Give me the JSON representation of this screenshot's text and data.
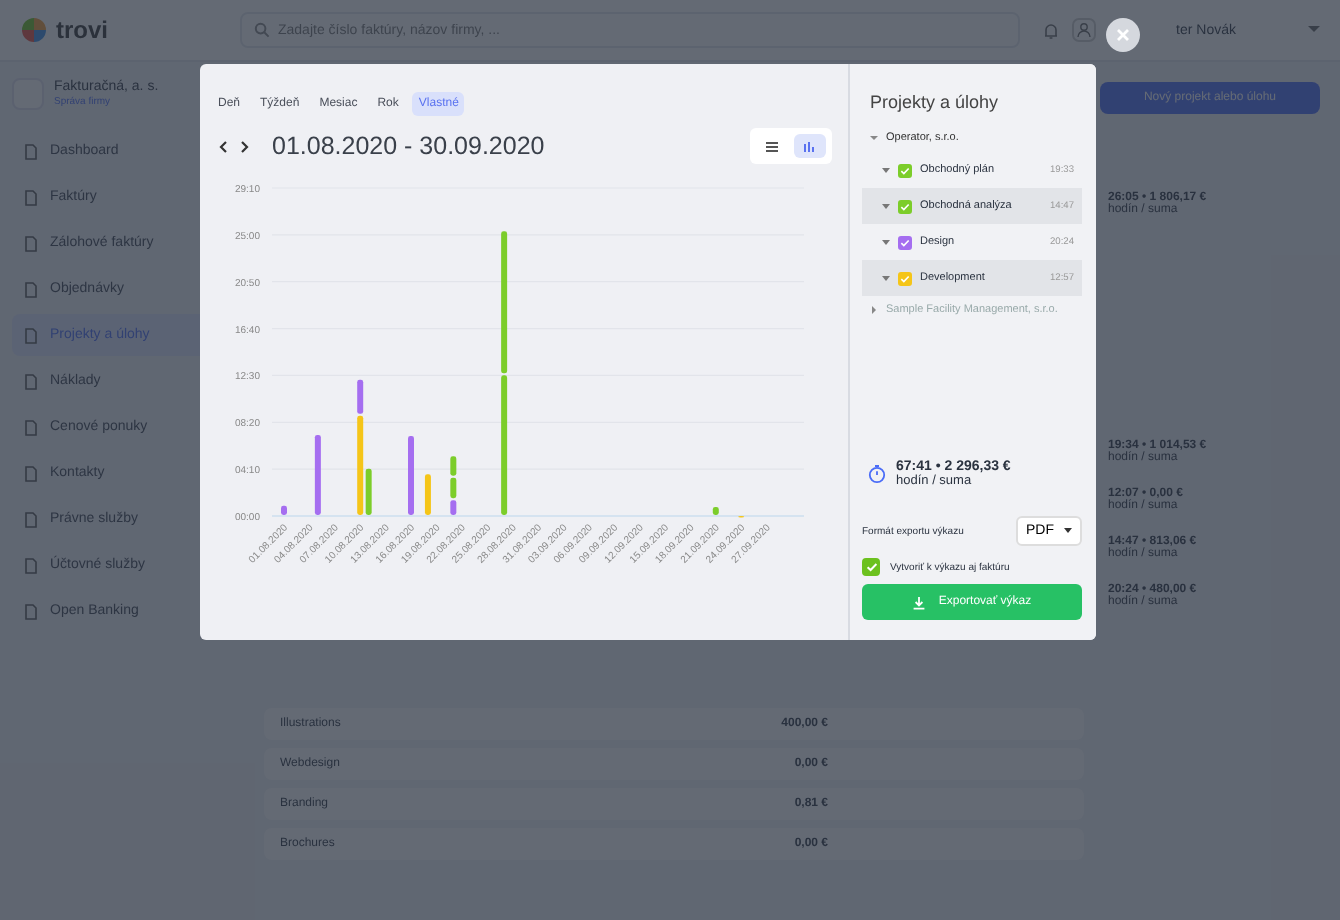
{
  "topbar": {
    "logo": "trovi",
    "search": {
      "placeholder": "Zadajte číslo faktúry, názov firmy, ..."
    },
    "user": "ter Novák"
  },
  "sidebar": {
    "company": "Fakturačná, a. s.",
    "company_link": "Správa firmy",
    "items": [
      {
        "label": "Dashboard",
        "selected": false
      },
      {
        "label": "Faktúry",
        "selected": false
      },
      {
        "label": "Zálohové faktúry",
        "selected": false
      },
      {
        "label": "Objednávky",
        "selected": false
      },
      {
        "label": "Projekty a úlohy",
        "selected": true
      },
      {
        "label": "Náklady",
        "selected": false
      },
      {
        "label": "Cenové ponuky",
        "selected": false
      },
      {
        "label": "Kontakty",
        "selected": false
      },
      {
        "label": "Právne služby",
        "selected": false
      },
      {
        "label": "Účtovné služby",
        "selected": false
      },
      {
        "label": "Open Banking",
        "selected": false
      }
    ]
  },
  "background": {
    "new_button": "Nový projekt alebo úlohu",
    "summaries": [
      {
        "value": "26:05 • 1 806,17 €",
        "caption": "hodín / suma"
      },
      {
        "value": "19:34 • 1 014,53 €",
        "caption": "hodín / suma"
      },
      {
        "value": "12:07 • 0,00 €",
        "caption": "hodín / suma"
      },
      {
        "value": "14:47 • 813,06 €",
        "caption": "hodín / suma"
      },
      {
        "value": "20:24 • 480,00 €",
        "caption": "hodín / suma"
      }
    ],
    "rows": [
      {
        "name": "Illustrations",
        "amount": "400,00 €"
      },
      {
        "name": "Webdesign",
        "amount": "0,00 €"
      },
      {
        "name": "Branding",
        "amount": "0,81 €"
      },
      {
        "name": "Brochures",
        "amount": "0,00 €"
      }
    ]
  },
  "modal": {
    "periods": [
      {
        "label": "Deň",
        "selected": false
      },
      {
        "label": "Týždeň",
        "selected": false
      },
      {
        "label": "Mesiac",
        "selected": false
      },
      {
        "label": "Rok",
        "selected": false
      },
      {
        "label": "Vlastné",
        "selected": true
      }
    ],
    "range": "01.08.2020 - 30.09.2020",
    "views": [
      {
        "kind": "list",
        "selected": false
      },
      {
        "kind": "chart",
        "selected": true
      }
    ],
    "chart": {
      "chart_data": {
        "type": "bar",
        "stacked": true,
        "grid": true,
        "categories": [
          "01.08.2020",
          null,
          null,
          "04.08.2020",
          null,
          null,
          "07.08.2020",
          null,
          null,
          "10.08.2020",
          null,
          null,
          "13.08.2020",
          null,
          null,
          "16.08.2020",
          null,
          null,
          "19.08.2020",
          null,
          null,
          "22.08.2020",
          null,
          null,
          "25.08.2020",
          null,
          null,
          "28.08.2020",
          null,
          null,
          "31.08.2020",
          null,
          null,
          "03.09.2020",
          null,
          null,
          "06.09.2020",
          null,
          null,
          "09.09.2020",
          null,
          null,
          "12.09.2020",
          null,
          null,
          "15.09.2020",
          null,
          null,
          "18.09.2020",
          null,
          null,
          "21.09.2020",
          null,
          null,
          "24.09.2020",
          null,
          null,
          "27.09.2020",
          null,
          null,
          null
        ],
        "series": [
          {
            "color": "#f5c518",
            "values": [
              null,
              null,
              null,
              null,
              null,
              null,
              null,
              null,
              null,
              9,
              null,
              null,
              null,
              null,
              null,
              null,
              null,
              3.8,
              null,
              null,
              null,
              null,
              null,
              null,
              null,
              null,
              null,
              null,
              null,
              null,
              null,
              null,
              null,
              null,
              null,
              null,
              null,
              null,
              null,
              null,
              null,
              null,
              null,
              null,
              null,
              null,
              null,
              null,
              null,
              null,
              null,
              null,
              null,
              null,
              0.1,
              null,
              null,
              null,
              null,
              null,
              null
            ]
          },
          {
            "color": "#a56ef0",
            "values": [
              1,
              null,
              null,
              null,
              7.3,
              null,
              null,
              null,
              null,
              3.2,
              null,
              null,
              null,
              null,
              null,
              7.2,
              null,
              null,
              null,
              null,
              1.5,
              null,
              null,
              null,
              null,
              null,
              null,
              null,
              null,
              null,
              null,
              null,
              null,
              null,
              null,
              null,
              null,
              null,
              null,
              null,
              null,
              null,
              null,
              null,
              null,
              null,
              null,
              null,
              null,
              null,
              null,
              null,
              null,
              null,
              null,
              null,
              null,
              null,
              null,
              null,
              null
            ]
          },
          {
            "color": "#7ccd2a",
            "values": [
              null,
              null,
              null,
              null,
              null,
              null,
              null,
              null,
              null,
              null,
              4.3,
              null,
              null,
              null,
              null,
              null,
              null,
              null,
              null,
              null,
              2,
              null,
              null,
              null,
              null,
              null,
              12.6,
              null,
              null,
              null,
              null,
              null,
              null,
              null,
              null,
              null,
              null,
              null,
              null,
              null,
              null,
              null,
              null,
              null,
              null,
              null,
              null,
              null,
              null,
              null,
              null,
              0.9,
              null,
              null,
              null,
              null,
              null,
              null,
              null,
              null,
              null
            ]
          },
          {
            "color": "#7ccd2a",
            "values": [
              null,
              null,
              null,
              null,
              null,
              null,
              null,
              null,
              null,
              null,
              null,
              null,
              null,
              null,
              null,
              null,
              null,
              null,
              null,
              null,
              1.9,
              null,
              null,
              null,
              null,
              null,
              12.8,
              null,
              null,
              null,
              null,
              null,
              null,
              null,
              null,
              null,
              null,
              null,
              null,
              null,
              null,
              null,
              null,
              null,
              null,
              null,
              null,
              null,
              null,
              null,
              null,
              null,
              null,
              null,
              null,
              null,
              null,
              null,
              null,
              null,
              null
            ]
          }
        ],
        "ylim": [
          0,
          29.1667
        ],
        "yticks": [
          {
            "value": 0,
            "label": "00:00"
          },
          {
            "value": 4.1667,
            "label": "04:10"
          },
          {
            "value": 8.3333,
            "label": "08:20"
          },
          {
            "value": 12.5,
            "label": "12:30"
          },
          {
            "value": 16.6667,
            "label": "16:40"
          },
          {
            "value": 20.8333,
            "label": "20:50"
          },
          {
            "value": 25,
            "label": "25:00"
          },
          {
            "value": 29.1667,
            "label": "29:10"
          }
        ]
      }
    },
    "panel": {
      "title": "Projekty a úlohy",
      "tree": [
        {
          "label": "Operator, s.r.o.",
          "expanded": true,
          "children": [
            {
              "label": "Obchodný plán",
              "time": "19:33",
              "checked": true,
              "color": "#7ccd2a"
            },
            {
              "label": "Obchodná analýza",
              "time": "14:47",
              "checked": true,
              "color": "#7ccd2a"
            },
            {
              "label": "Design",
              "time": "20:24",
              "checked": true,
              "color": "#a56ef0"
            },
            {
              "label": "Development",
              "time": "12:57",
              "checked": true,
              "color": "#f5c518"
            }
          ]
        },
        {
          "label": "Sample Facility Management, s.r.o.",
          "expanded": false
        }
      ],
      "total": "67:41 • 2 296,33 €",
      "total_caption": "hodín / suma",
      "format_label": "Formát exportu výkazu",
      "format": "PDF",
      "invoice": {
        "label": "Vytvoriť k výkazu aj faktúru",
        "checked": true
      },
      "export_button": "Exportovať výkaz"
    }
  }
}
